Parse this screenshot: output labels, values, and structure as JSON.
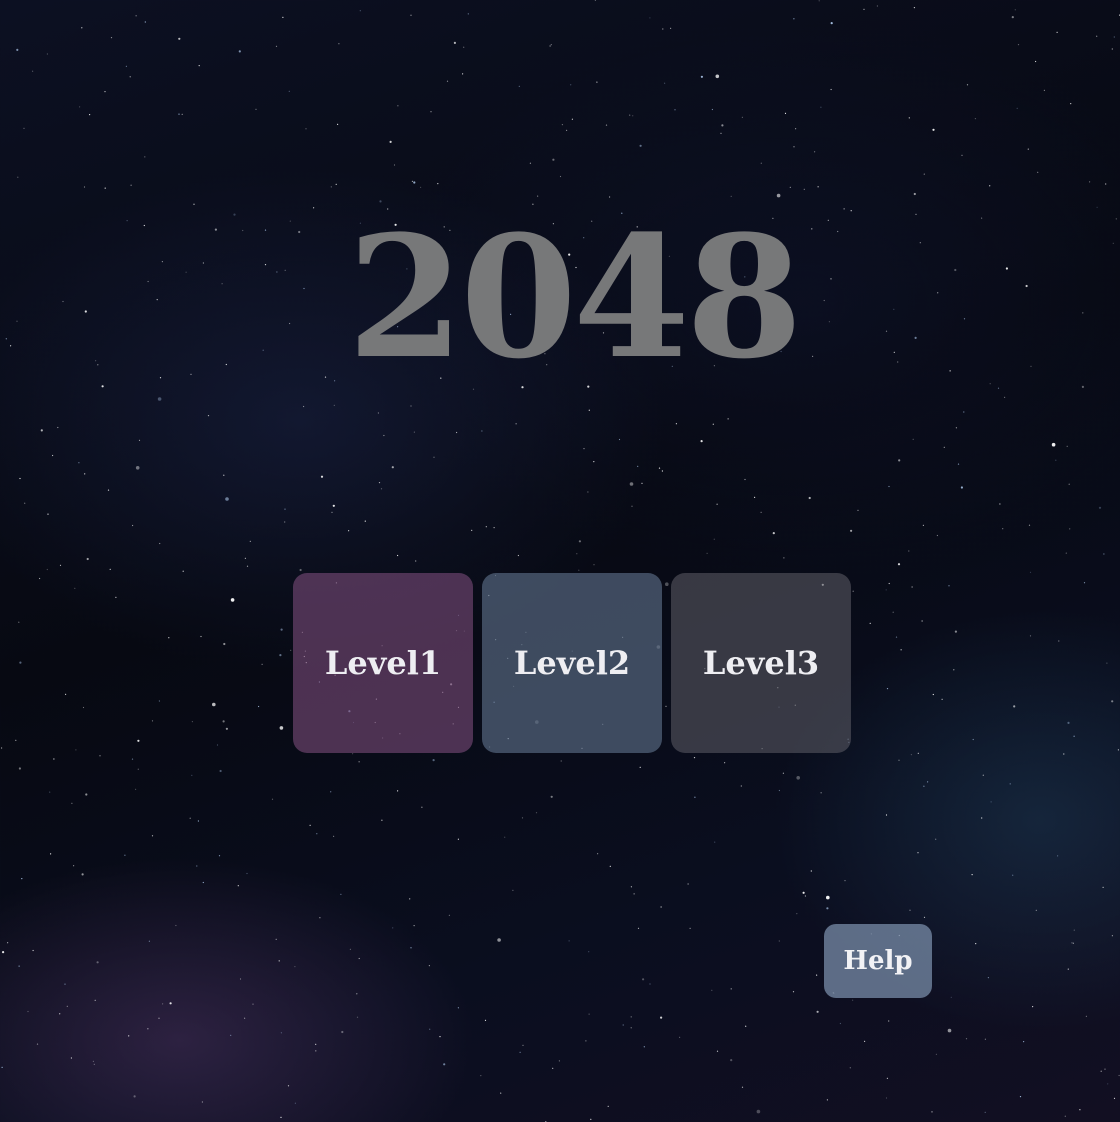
{
  "game": {
    "title": "2048"
  },
  "levels": [
    {
      "label": "Level1",
      "color": "#6b4466"
    },
    {
      "label": "Level2",
      "color": "#4b5a6e"
    },
    {
      "label": "Level3",
      "color": "#3f3f46"
    }
  ],
  "help": {
    "label": "Help",
    "color": "#6e7f98"
  },
  "background": {
    "theme": "starfield",
    "base_color": "#080a14"
  }
}
